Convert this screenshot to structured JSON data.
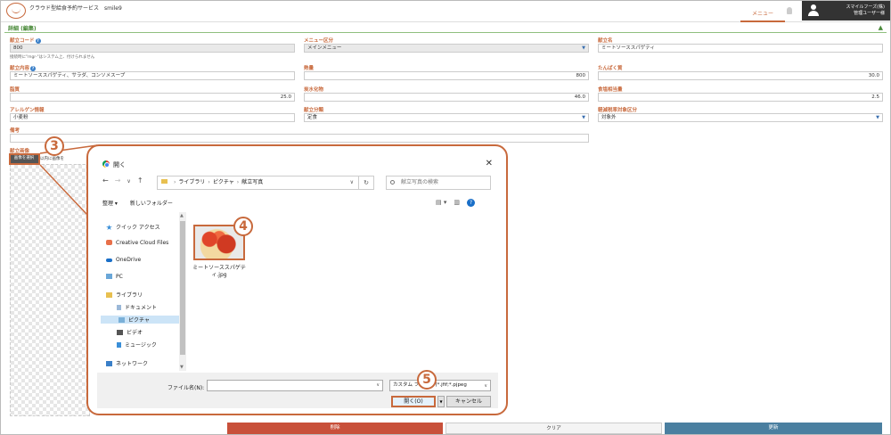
{
  "header": {
    "app_title": "クラウド型給食予約サービス　smile9",
    "menu_label": "メニュー",
    "user_line1": "スマイルフーズ(株)",
    "user_line2": "管理ユーザー様"
  },
  "section": {
    "title": "詳細 (編集)",
    "collapse_glyph": "▲"
  },
  "form": {
    "code": {
      "label": "献立コード",
      "value": "800",
      "note": "接続時に\"mgr-\"はシステム上、付けられません"
    },
    "menu_type": {
      "label": "メニュー区分",
      "value": "メインメニュー"
    },
    "name": {
      "label": "献立名",
      "value": "ミートソーススパゲティ"
    },
    "content": {
      "label": "献立内容",
      "value": "ミートソーススパゲティ、サラダ、コンソメスープ"
    },
    "calorie": {
      "label": "熱量",
      "value": "800"
    },
    "protein": {
      "label": "たんぱく質",
      "value": "30.0"
    },
    "fat": {
      "label": "脂質",
      "value": "25.0"
    },
    "carb": {
      "label": "炭水化物",
      "value": "46.0"
    },
    "salt": {
      "label": "食塩相当量",
      "value": "2.5"
    },
    "allergen": {
      "label": "アレルゲン情報",
      "value": "小麦粉"
    },
    "category": {
      "label": "献立分類",
      "value": "定食"
    },
    "tax": {
      "label": "軽減税率対象区分",
      "value": "対象外"
    },
    "remarks": {
      "label": "備考",
      "value": ""
    },
    "image": {
      "label": "献立画像",
      "button": "画像を選択",
      "note": "jpg,png形式で512KB以内に画像を",
      "note_short": "以内に画像を"
    }
  },
  "bottom_buttons": {
    "delete": "削除",
    "clear": "クリア",
    "update": "更新"
  },
  "callouts": {
    "c3": "3",
    "c4": "4",
    "c5": "5"
  },
  "dialog": {
    "title": "開く",
    "close": "✕",
    "nav": {
      "back": "←",
      "forward": "→",
      "dropdown": "∨",
      "up": "↑"
    },
    "breadcrumb": [
      "ライブラリ",
      "ピクチャ",
      "献立写真"
    ],
    "search_placeholder": "献立写真の検索",
    "toolbar": {
      "organize": "整理 ▾",
      "new_folder": "新しいフォルダー"
    },
    "nav_items": [
      {
        "label": "クイック アクセス"
      },
      {
        "label": "Creative Cloud Files"
      },
      {
        "label": "OneDrive"
      },
      {
        "label": "PC"
      },
      {
        "label": "ライブラリ"
      },
      {
        "label": "ドキュメント"
      },
      {
        "label": "ピクチャ"
      },
      {
        "label": "ビデオ"
      },
      {
        "label": "ミュージック"
      },
      {
        "label": "ネットワーク"
      }
    ],
    "file": {
      "name_line1": "ミートソーススパゲテ",
      "name_line2": "ィ.jpg"
    },
    "filename_label": "ファイル名(N):",
    "filter_value": "カスタム ファイル (*.jfif;*.pjpeg",
    "open_label": "開く(O)",
    "cancel_label": "キャンセル"
  },
  "colors": {
    "accent": "#c8693c",
    "green": "#4a8a3a",
    "delete": "#c8503a",
    "update": "#4a7fa0"
  }
}
